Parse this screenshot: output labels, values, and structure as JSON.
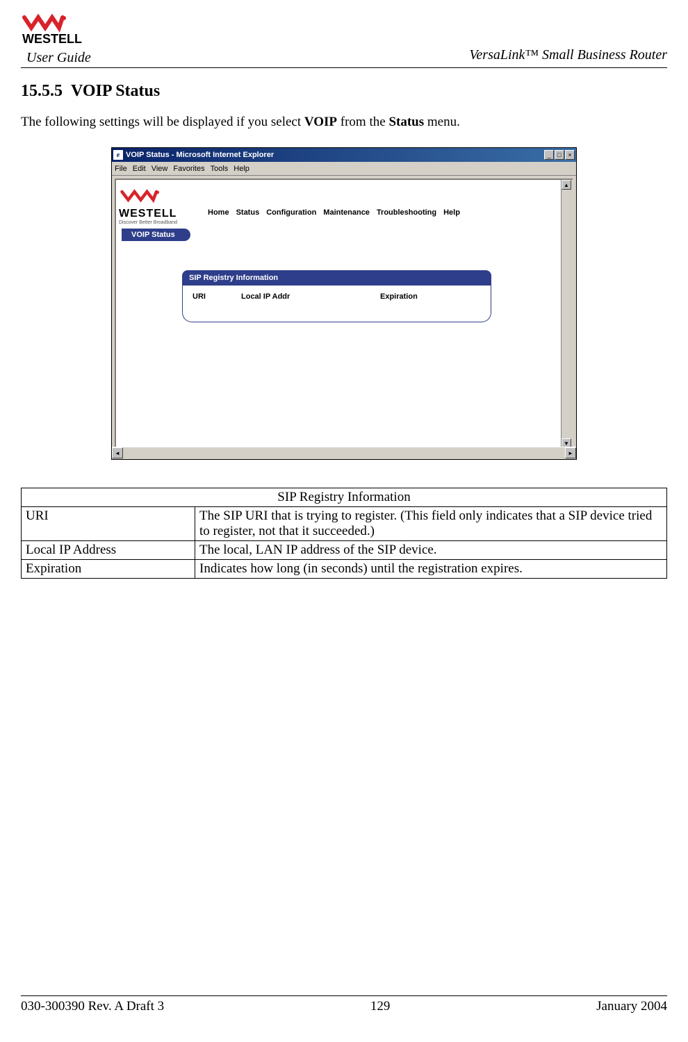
{
  "header": {
    "user_guide": "User Guide",
    "product_name": "VersaLink™  Small Business Router",
    "logo_text": "WESTELL"
  },
  "section": {
    "number": "15.5.5",
    "title": "VOIP Status"
  },
  "intro": {
    "prefix": "The following settings will be displayed if you select ",
    "bold1": "VOIP",
    "mid": " from the ",
    "bold2": "Status",
    "suffix": " menu."
  },
  "ie": {
    "title": "VOIP Status - Microsoft Internet Explorer",
    "menus": [
      "File",
      "Edit",
      "View",
      "Favorites",
      "Tools",
      "Help"
    ],
    "win_min": "_",
    "win_max": "□",
    "win_close": "×"
  },
  "app": {
    "logo_text": "WESTELL",
    "tagline": "Discover  Better  Broadband",
    "nav": [
      "Home",
      "Status",
      "Configuration",
      "Maintenance",
      "Troubleshooting",
      "Help"
    ],
    "tab_label": "VOIP Status",
    "panel_header": "SIP Registry Information",
    "cols": {
      "uri": "URI",
      "local_ip": "Local IP Addr",
      "expiration": "Expiration"
    }
  },
  "scrollbar": {
    "up": "▲",
    "down": "▼",
    "left": "◄",
    "right": "►"
  },
  "table": {
    "header": "SIP Registry Information",
    "rows": [
      {
        "label": "URI",
        "desc": "The SIP URI that is trying to register. (This field only indicates that a SIP device tried to register, not that it succeeded.)"
      },
      {
        "label": "Local IP Address",
        "desc": "The local, LAN IP address of the SIP device."
      },
      {
        "label": "Expiration",
        "desc": "Indicates how long (in seconds) until the registration expires."
      }
    ]
  },
  "footer": {
    "left": "030-300390 Rev. A Draft 3",
    "center": "129",
    "right": "January 2004"
  }
}
